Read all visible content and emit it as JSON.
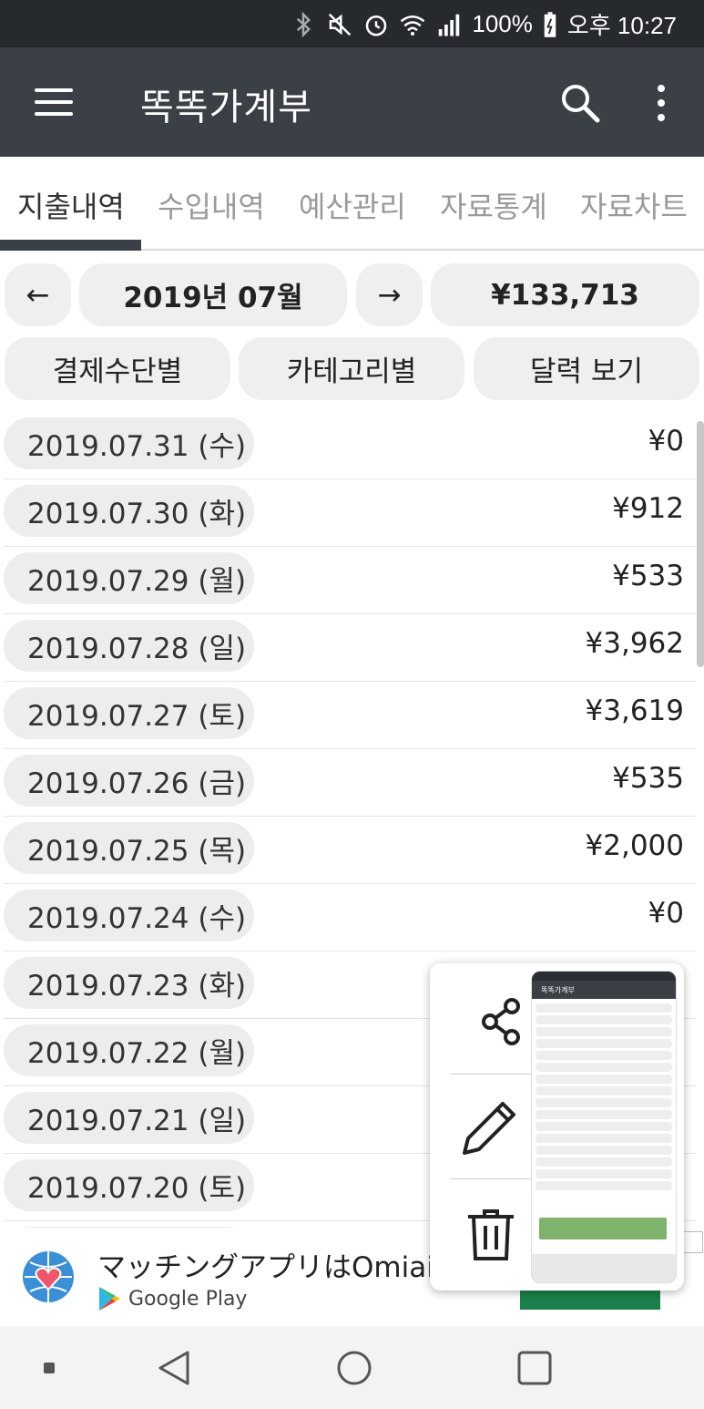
{
  "status_bar": {
    "battery": "100%",
    "time": "오후 10:27"
  },
  "app_bar": {
    "title": "똑똑가계부"
  },
  "tabs": [
    {
      "label": "지출내역",
      "active": true
    },
    {
      "label": "수입내역",
      "active": false
    },
    {
      "label": "예산관리",
      "active": false
    },
    {
      "label": "자료통계",
      "active": false
    },
    {
      "label": "자료차트",
      "active": false
    }
  ],
  "period": {
    "prev_label": "←",
    "month": "2019년 07월",
    "next_label": "→",
    "total": "¥133,713"
  },
  "views": {
    "by_payment": "결제수단별",
    "by_category": "카테고리별",
    "calendar": "달력 보기"
  },
  "entries": [
    {
      "date": "2019.07.31 (수)",
      "amount": "¥0"
    },
    {
      "date": "2019.07.30 (화)",
      "amount": "¥912"
    },
    {
      "date": "2019.07.29 (월)",
      "amount": "¥533"
    },
    {
      "date": "2019.07.28 (일)",
      "amount": "¥3,962"
    },
    {
      "date": "2019.07.27 (토)",
      "amount": "¥3,619"
    },
    {
      "date": "2019.07.26 (금)",
      "amount": "¥535"
    },
    {
      "date": "2019.07.25 (목)",
      "amount": "¥2,000"
    },
    {
      "date": "2019.07.24 (수)",
      "amount": "¥0"
    },
    {
      "date": "2019.07.23 (화)",
      "amount": ""
    },
    {
      "date": "2019.07.22 (월)",
      "amount": ""
    },
    {
      "date": "2019.07.21 (일)",
      "amount": ""
    },
    {
      "date": "2019.07.20 (토)",
      "amount": ""
    }
  ],
  "ad": {
    "title": "マッチングアプリはOmiai.",
    "store": "Google Play"
  },
  "colors": {
    "app_bar": "#3b4047",
    "status_bar": "#262a2e",
    "pill_bg": "#efefef",
    "ad_cta": "#1a7f4b"
  },
  "icons": [
    "bluetooth-icon",
    "mute-icon",
    "alarm-icon",
    "wifi-icon",
    "signal-icon",
    "battery-icon",
    "menu-icon",
    "search-icon",
    "more-vert-icon",
    "share-icon",
    "edit-icon",
    "delete-icon",
    "omiai-logo-icon",
    "google-play-icon",
    "nav-back-icon",
    "nav-home-icon",
    "nav-recents-icon"
  ]
}
